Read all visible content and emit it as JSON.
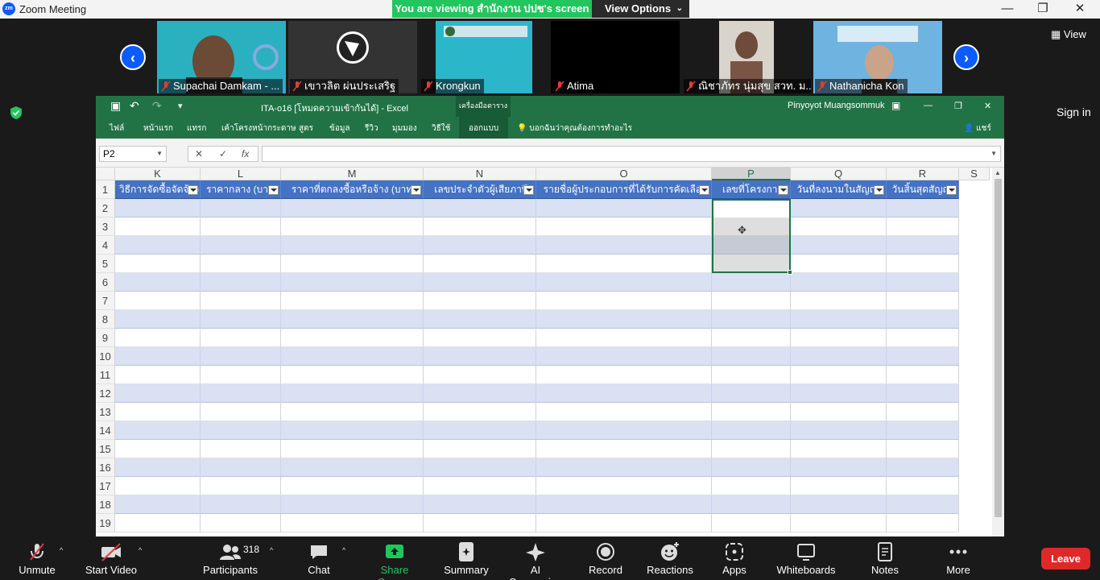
{
  "window": {
    "title": "Zoom Meeting",
    "minimize": "—",
    "restore": "❐",
    "close": "✕"
  },
  "banner": {
    "viewing_text": "You are viewing สำนักงาน ปปช's screen",
    "view_options_label": "View Options",
    "view_options_caret": "⌄"
  },
  "gallery": {
    "view_label": "View",
    "prev_arrow": "‹",
    "next_arrow": "›",
    "participants": [
      {
        "name": "Supachai Damkam - ...",
        "bg": "#2bb0c0"
      },
      {
        "name": "เขาวลิต ผ่นประเสริฐ",
        "bg": "#333333"
      },
      {
        "name": "Krongkun",
        "bg": "#2bb7c9"
      },
      {
        "name": "Atima",
        "bg": "#000000"
      },
      {
        "name": "ณิชาภัทร นุ่มสุข สวท. ม...",
        "bg": "#d8d4cc"
      },
      {
        "name": "Nathanicha Kon",
        "bg": "#6fb3e0"
      }
    ]
  },
  "side": {
    "sign_in": "Sign in"
  },
  "excel": {
    "doc_title": "ITA-o16 [โหมดความเข้ากันได้] - Excel",
    "tools_label": "เครื่องมือตาราง",
    "user_name": "Pinyoyot Muangsommuk",
    "qat": {
      "save": "▣",
      "undo": "↶",
      "redo": "↷",
      "more": "▾"
    },
    "share_label": "แชร์",
    "ribbon_tabs": [
      "ไฟล์",
      "หน้าแรก",
      "แทรก",
      "เค้าโครงหน้ากระดาษ",
      "สูตร",
      "ข้อมูล",
      "รีวิว",
      "มุมมอง",
      "วิธีใช้",
      "ออกแบบ"
    ],
    "tell_me": "บอกฉันว่าคุณต้องการทำอะไร",
    "name_box": "P2",
    "fx": {
      "cancel": "✕",
      "enter": "✓",
      "fx": "fx"
    },
    "columns": [
      "K",
      "L",
      "M",
      "N",
      "O",
      "P",
      "Q",
      "R",
      "S"
    ],
    "selected_column": "P",
    "header_row": [
      "วิธีการจัดซื้อจัดจ้าง",
      "ราคากลาง (บาท)",
      "ราคาที่ตกลงซื้อหรือจ้าง (บาท)",
      "เลขประจำตัวผู้เสียภาษี",
      "รายชื่อผู้ประกอบการที่ได้รับการคัดเลือก",
      "เลขที่โครงการ",
      "วันที่ลงนามในสัญญา",
      "วันสิ้นสุดสัญญา"
    ],
    "row_numbers": [
      "1",
      "2",
      "3",
      "4",
      "5",
      "6",
      "7",
      "8",
      "9",
      "10",
      "11",
      "12",
      "13",
      "14",
      "15",
      "16",
      "17",
      "18",
      "19"
    ]
  },
  "toolbar": {
    "unmute": "Unmute",
    "start_video": "Start Video",
    "participants": "Participants",
    "participant_count": "318",
    "chat": "Chat",
    "share_screen": "Share Screen",
    "summary": "Summary",
    "ai_companion": "AI Companion",
    "record": "Record",
    "reactions": "Reactions",
    "apps": "Apps",
    "whiteboards": "Whiteboards",
    "notes": "Notes",
    "more": "More",
    "leave": "Leave",
    "caret": "^"
  },
  "colors": {
    "excel_green": "#217346",
    "table_header": "#4472c4",
    "table_band": "#d9e1f2",
    "zoom_blue": "#0b5cff",
    "share_green": "#23c55e",
    "leave_red": "#e02828"
  }
}
